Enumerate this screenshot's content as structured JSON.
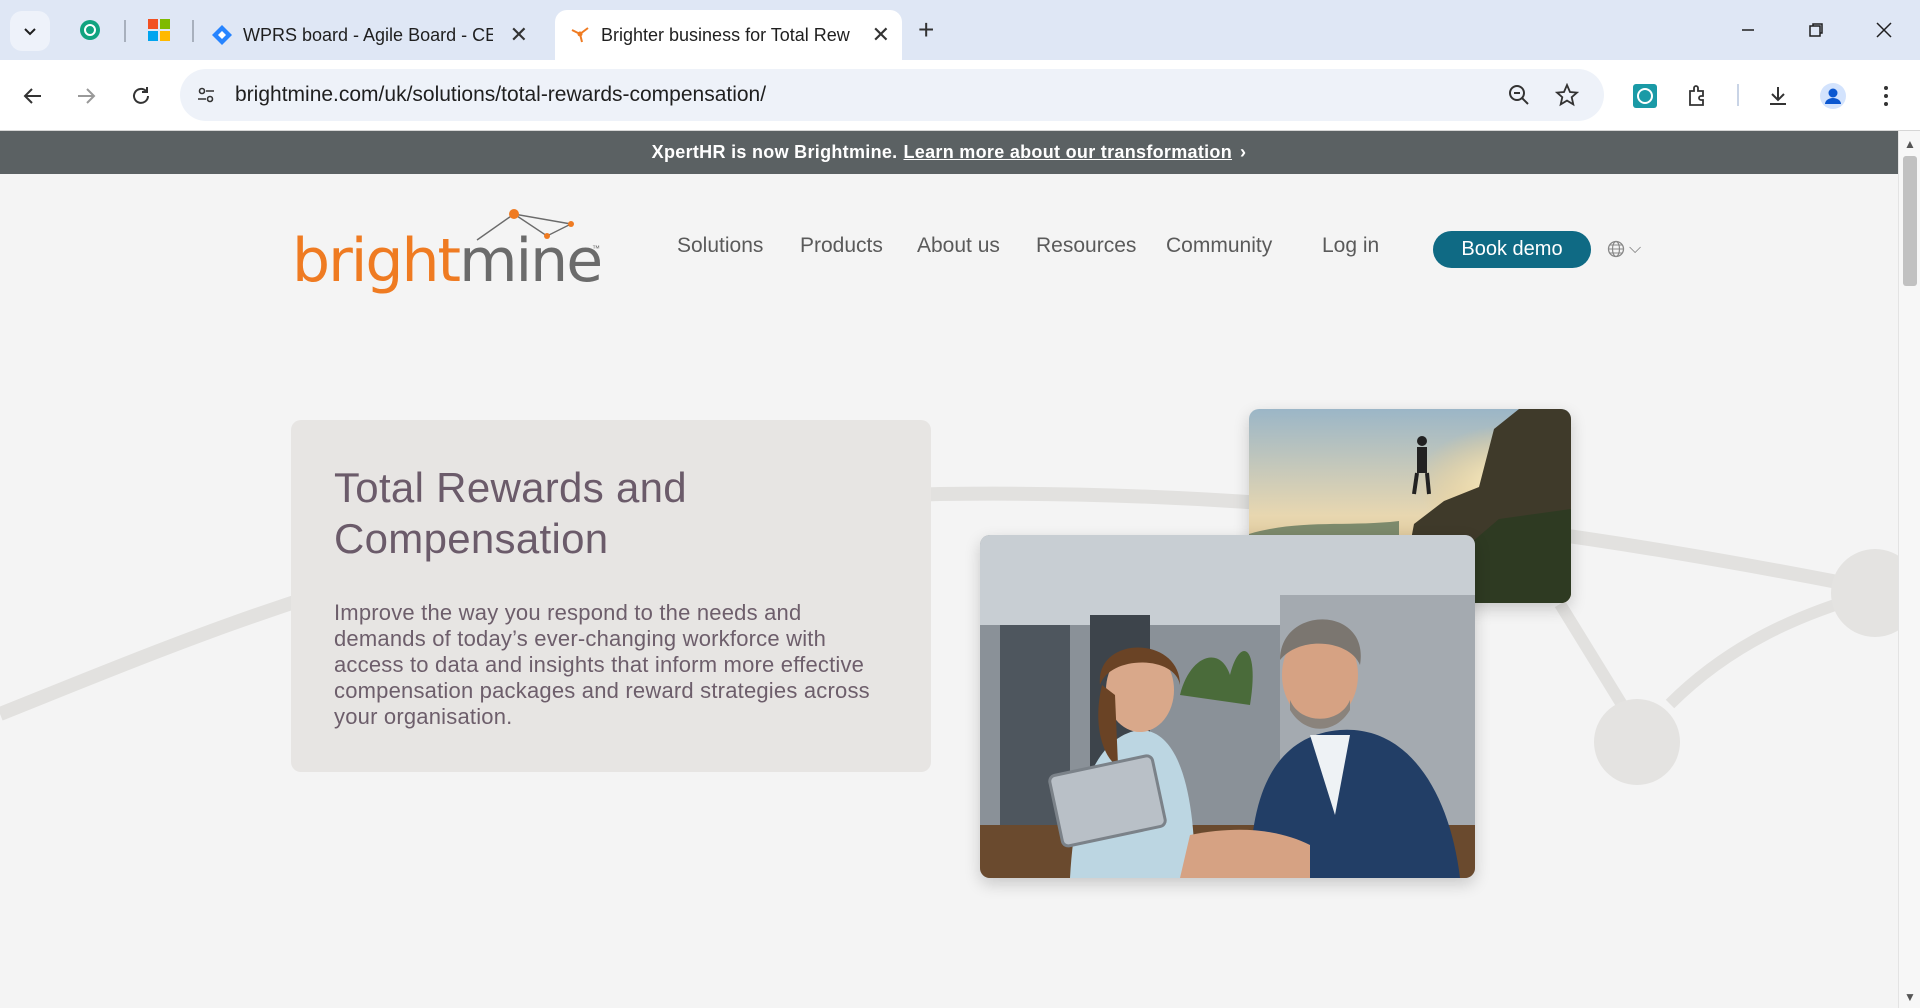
{
  "browser": {
    "tabs": [
      {
        "title": "WPRS board - Agile Board - CE",
        "active": false
      },
      {
        "title": "Brighter business for Total Rew",
        "active": true
      }
    ],
    "new_tab_label": "+",
    "url": "brightmine.com/uk/solutions/total-rewards-compensation/"
  },
  "announcement": {
    "text": "XpertHR is now Brightmine.",
    "link": "Learn more about our transformation",
    "chevron": "›"
  },
  "site": {
    "logo": {
      "part1": "bright",
      "part2": "mine",
      "tm": "™"
    },
    "nav": [
      "Solutions",
      "Products",
      "About us",
      "Resources",
      "Community"
    ],
    "login": "Log in",
    "cta": "Book demo",
    "lang_chevron": "⌵"
  },
  "hero": {
    "title": "Total Rewards and Compensation",
    "body": "Improve the way you respond to the needs and demands of today’s ever-changing workforce with access to data and insights that inform more effective compensation packages and reward strategies across your organisation."
  },
  "colors": {
    "brand_orange": "#ef7b22",
    "brand_teal": "#0f6a84",
    "heading_purple": "#6b5b6a",
    "announcement_bg": "#5b6163"
  },
  "icons": [
    "tab-search-icon",
    "chatgpt-icon",
    "microsoft-icon",
    "jira-icon",
    "brightmine-favicon",
    "back-icon",
    "forward-icon",
    "reload-icon",
    "site-settings-icon",
    "zoom-icon",
    "bookmark-star-icon",
    "extension-icon",
    "puzzle-icon",
    "download-icon",
    "profile-icon",
    "menu-icon",
    "globe-icon"
  ]
}
